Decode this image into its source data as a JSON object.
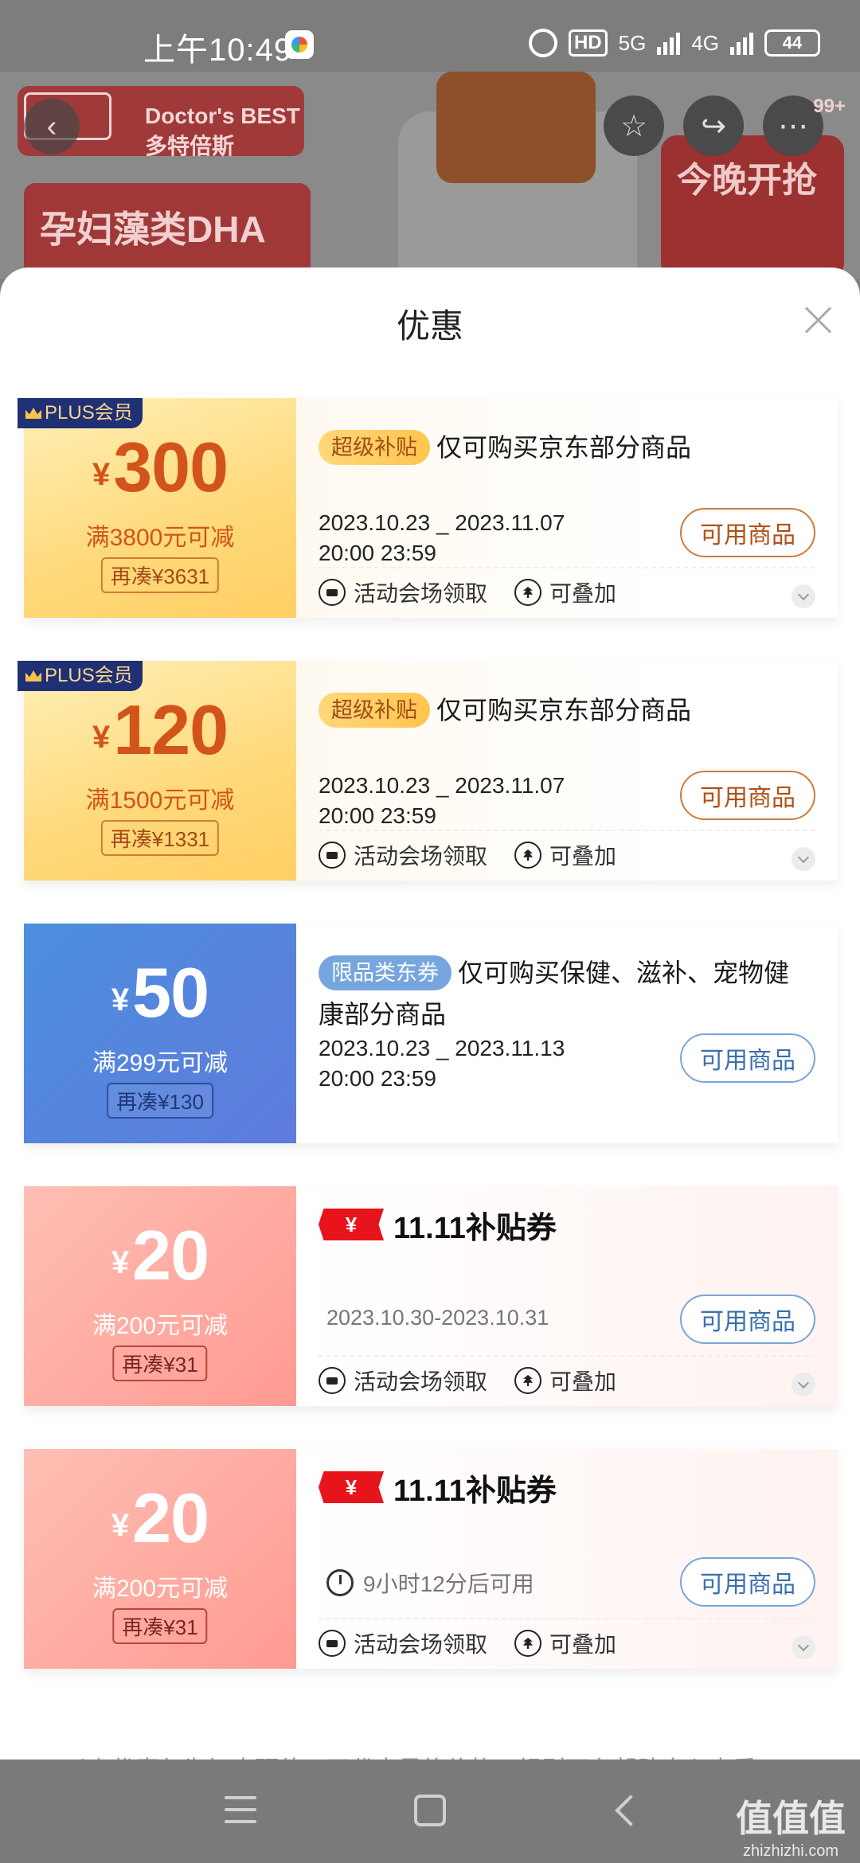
{
  "status_bar": {
    "time": "上午10:49",
    "hd_label": "HD",
    "network_5g": "5G",
    "network_4g": "4G",
    "battery": "44"
  },
  "hero": {
    "brand_text": "Doctor's BEST多特倍斯",
    "product_title": "孕妇藻类DHA",
    "promo_text": "今晚开抢",
    "notification_count": "99+"
  },
  "sheet": {
    "title": "优惠"
  },
  "coupons": [
    {
      "member_tag": "PLUS会员",
      "currency": "¥",
      "amount": "300",
      "threshold": "满3800元可减",
      "gap": "再凑¥3631",
      "tag": "超级补贴",
      "title": "仅可购买京东部分商品",
      "date_line1": "2023.10.23 _ 2023.11.07",
      "date_line2": "20:00 23:59",
      "button": "可用商品",
      "source": "活动会场领取",
      "stackable": "可叠加"
    },
    {
      "member_tag": "PLUS会员",
      "currency": "¥",
      "amount": "120",
      "threshold": "满1500元可减",
      "gap": "再凑¥1331",
      "tag": "超级补贴",
      "title": "仅可购买京东部分商品",
      "date_line1": "2023.10.23 _ 2023.11.07",
      "date_line2": "20:00 23:59",
      "button": "可用商品",
      "source": "活动会场领取",
      "stackable": "可叠加"
    },
    {
      "currency": "¥",
      "amount": "50",
      "threshold": "满299元可减",
      "gap": "再凑¥130",
      "tag": "限品类东券",
      "title": "仅可购买保健、滋补、宠物健康部分商品",
      "date_line1": "2023.10.23 _ 2023.11.13",
      "date_line2": "20:00 23:59",
      "button": "可用商品"
    },
    {
      "currency": "¥",
      "amount": "20",
      "threshold": "满200元可减",
      "gap": "再凑¥31",
      "logo_flag": "¥",
      "logo_text": "11.11补贴券",
      "date_range": "2023.10.30-2023.10.31",
      "button": "可用商品",
      "source": "活动会场领取",
      "stackable": "可叠加"
    },
    {
      "currency": "¥",
      "amount": "20",
      "threshold": "满200元可减",
      "gap": "再凑¥31",
      "logo_flag": "¥",
      "logo_text": "11.11补贴券",
      "countdown": "9小时12分后可用",
      "button": "可用商品",
      "source": "活动会场领取",
      "stackable": "可叠加"
    }
  ],
  "disclaimer": "以上优惠仅为初步预估，不代表最终价格，规则可在帮助中心查看",
  "watermark": {
    "title": "值值值",
    "url": "zhizhizhi.com"
  },
  "colors": {
    "gold_amount": "#d2541a",
    "blue_coupon": "#5e7bdb",
    "pink_coupon": "#ff9a92",
    "subsidy_red": "#e8141b"
  }
}
